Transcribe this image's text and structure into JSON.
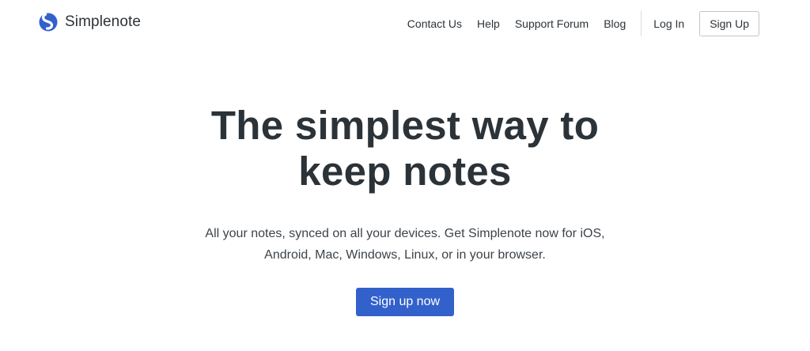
{
  "brand": {
    "name": "Simplenote",
    "logo_icon": "simplenote-s-logo-icon",
    "logo_color": "#3361cc"
  },
  "nav": {
    "links": [
      "Contact Us",
      "Help",
      "Support Forum",
      "Blog"
    ],
    "login_label": "Log In",
    "signup_label": "Sign Up"
  },
  "hero": {
    "title_line1": "The simplest way to",
    "title_line2": "keep notes",
    "subtitle_line1": "All your notes, synced on all your devices. Get Simplenote now for iOS,",
    "subtitle_line2": "Android, Mac, Windows, Linux, or in your browser.",
    "cta_label": "Sign up now",
    "cta_color": "#3361cc"
  }
}
